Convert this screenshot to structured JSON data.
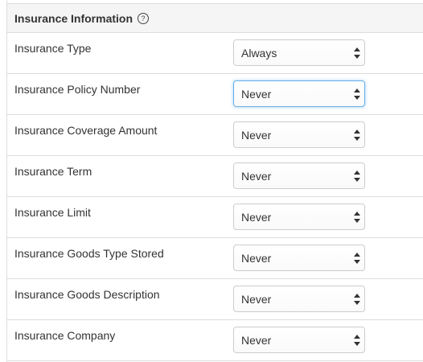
{
  "section": {
    "title": "Insurance Information",
    "help_icon": "?"
  },
  "fields": [
    {
      "label": "Insurance Type",
      "value": "Always"
    },
    {
      "label": "Insurance Policy Number",
      "value": "Never"
    },
    {
      "label": "Insurance Coverage Amount",
      "value": "Never"
    },
    {
      "label": "Insurance Term",
      "value": "Never"
    },
    {
      "label": "Insurance Limit",
      "value": "Never"
    },
    {
      "label": "Insurance Goods Type Stored",
      "value": "Never"
    },
    {
      "label": "Insurance Goods Description",
      "value": "Never"
    },
    {
      "label": "Insurance Company",
      "value": "Never"
    }
  ],
  "icons": {
    "help": "help-circle-icon",
    "select_arrows": "up-down-caret-icon"
  },
  "colors": {
    "header_bg": "#f5f5f5",
    "border": "#dddddd",
    "focus_ring": "#66afe9",
    "text": "#333333"
  }
}
